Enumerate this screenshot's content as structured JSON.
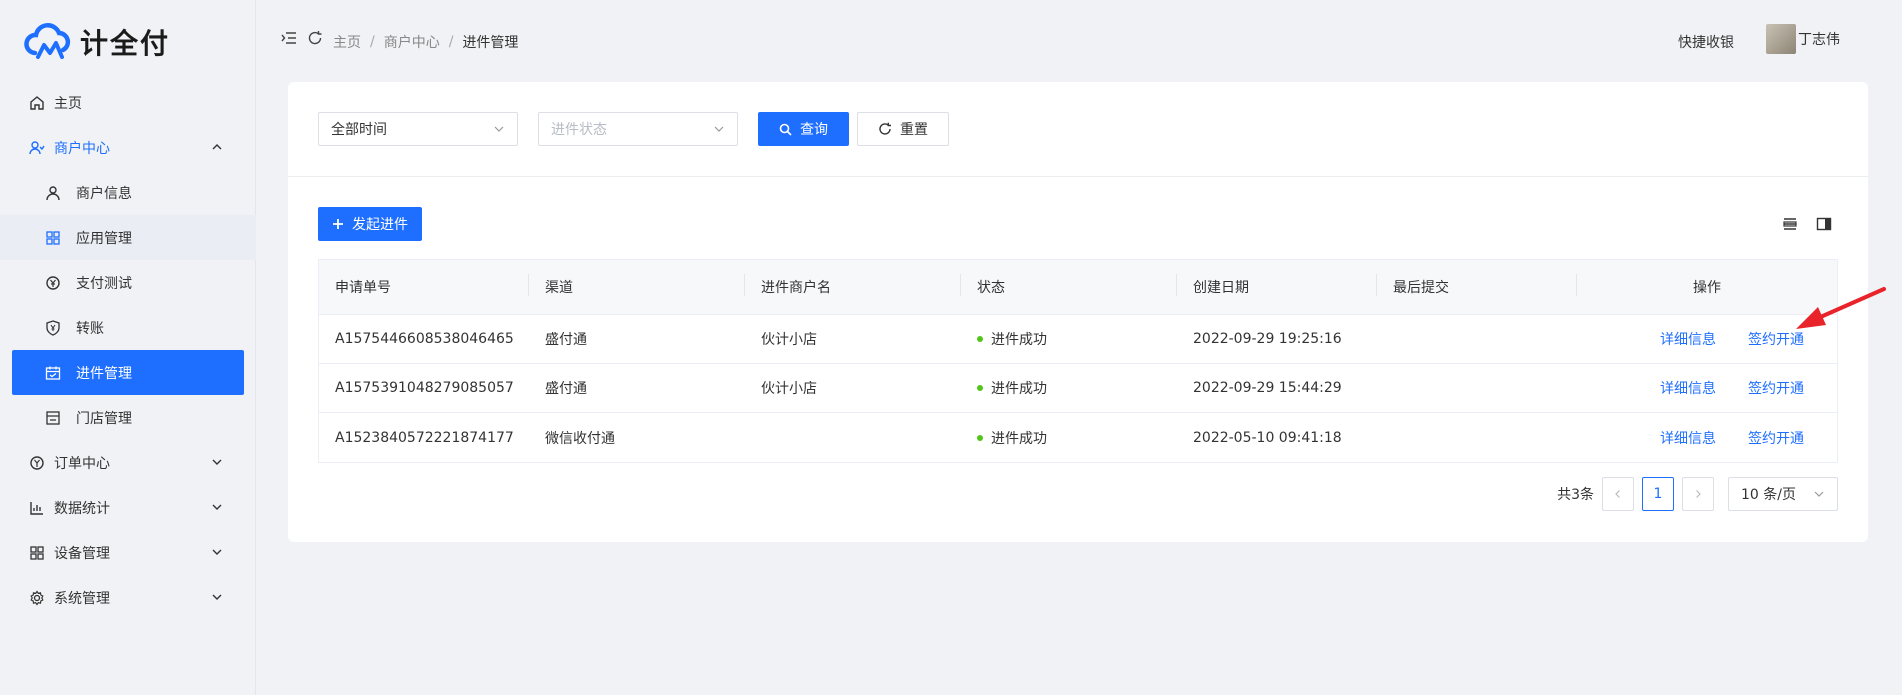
{
  "brand": {
    "name": "计全付"
  },
  "sidebar": {
    "items": [
      {
        "label": "主页",
        "icon": "home-icon"
      },
      {
        "label": "商户中心",
        "icon": "merchant-icon",
        "expanded": true,
        "children": [
          {
            "label": "商户信息",
            "icon": "user-icon"
          },
          {
            "label": "应用管理",
            "icon": "grid-icon"
          },
          {
            "label": "支付测试",
            "icon": "payment-icon"
          },
          {
            "label": "转账",
            "icon": "shield-yen-icon"
          },
          {
            "label": "进件管理",
            "icon": "calendar-icon",
            "selected": true
          },
          {
            "label": "门店管理",
            "icon": "store-icon"
          }
        ]
      },
      {
        "label": "订单中心",
        "icon": "order-icon"
      },
      {
        "label": "数据统计",
        "icon": "chart-icon"
      },
      {
        "label": "设备管理",
        "icon": "device-icon"
      },
      {
        "label": "系统管理",
        "icon": "gear-icon"
      }
    ]
  },
  "header": {
    "breadcrumb": [
      "主页",
      "商户中心",
      "进件管理"
    ],
    "quick_cashier": "快捷收银",
    "username": "丁志伟"
  },
  "filters": {
    "time_value": "全部时间",
    "status_placeholder": "进件状态",
    "search_label": "查询",
    "reset_label": "重置"
  },
  "toolbar": {
    "add_label": "发起进件"
  },
  "table": {
    "columns": [
      "申请单号",
      "渠道",
      "进件商户名",
      "状态",
      "创建日期",
      "最后提交",
      "操作"
    ],
    "rows": [
      {
        "id": "A1575446608538046465",
        "channel": "盛付通",
        "merchant": "伙计小店",
        "status": "进件成功",
        "created": "2022-09-29 19:25:16",
        "last": "",
        "op1": "详细信息",
        "op2": "签约开通"
      },
      {
        "id": "A1575391048279085057",
        "channel": "盛付通",
        "merchant": "伙计小店",
        "status": "进件成功",
        "created": "2022-09-29 15:44:29",
        "last": "",
        "op1": "详细信息",
        "op2": "签约开通"
      },
      {
        "id": "A1523840572221874177",
        "channel": "微信收付通",
        "merchant": "",
        "status": "进件成功",
        "created": "2022-05-10 09:41:18",
        "last": "",
        "op1": "详细信息",
        "op2": "签约开通"
      }
    ]
  },
  "pagination": {
    "total": "共3条",
    "current_page": "1",
    "page_size": "10 条/页"
  },
  "colors": {
    "primary": "#1e6fff",
    "success": "#52c41a",
    "annotation_arrow": "#e8242a"
  }
}
